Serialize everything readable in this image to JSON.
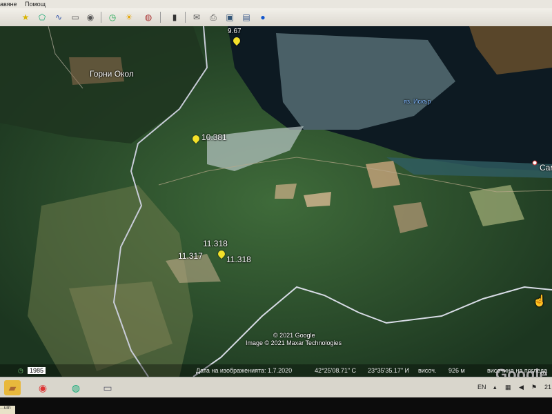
{
  "menu": {
    "item1": "авяне",
    "item2": "Помощ"
  },
  "toolbar": {
    "icons": [
      "placemark-icon",
      "polygon-icon",
      "path-icon",
      "overlay-icon",
      "record-tour-icon",
      "historical-imagery-icon",
      "sunlight-icon",
      "planets-icon",
      "ruler-icon",
      "email-icon",
      "print-icon",
      "save-image-icon",
      "view-in-maps-icon"
    ]
  },
  "map": {
    "places": {
      "gorni_okol": "Горни Окол",
      "reservoir": "яз. Искър",
      "sam": "Сам"
    },
    "markers": {
      "m1": "9.67",
      "m2": "10.381",
      "m3": "11.318",
      "m4": "11.317",
      "m5": "11.318"
    },
    "copyright1": "© 2021 Google",
    "copyright2": "Image © 2021 Maxar Technologies",
    "brand": "Google"
  },
  "status": {
    "year": "1985",
    "imagery_date": "Дата на изображенията: 1.7.2020",
    "lat": "42°25'08.71\" С",
    "lon": "23°35'35.17\" И",
    "elev_label": "височ.",
    "elev_value": "926 м",
    "eye_alt": "височина на погледа"
  },
  "taskbar": {
    "lang": "EN",
    "clock": "21"
  },
  "sticky": "...um"
}
